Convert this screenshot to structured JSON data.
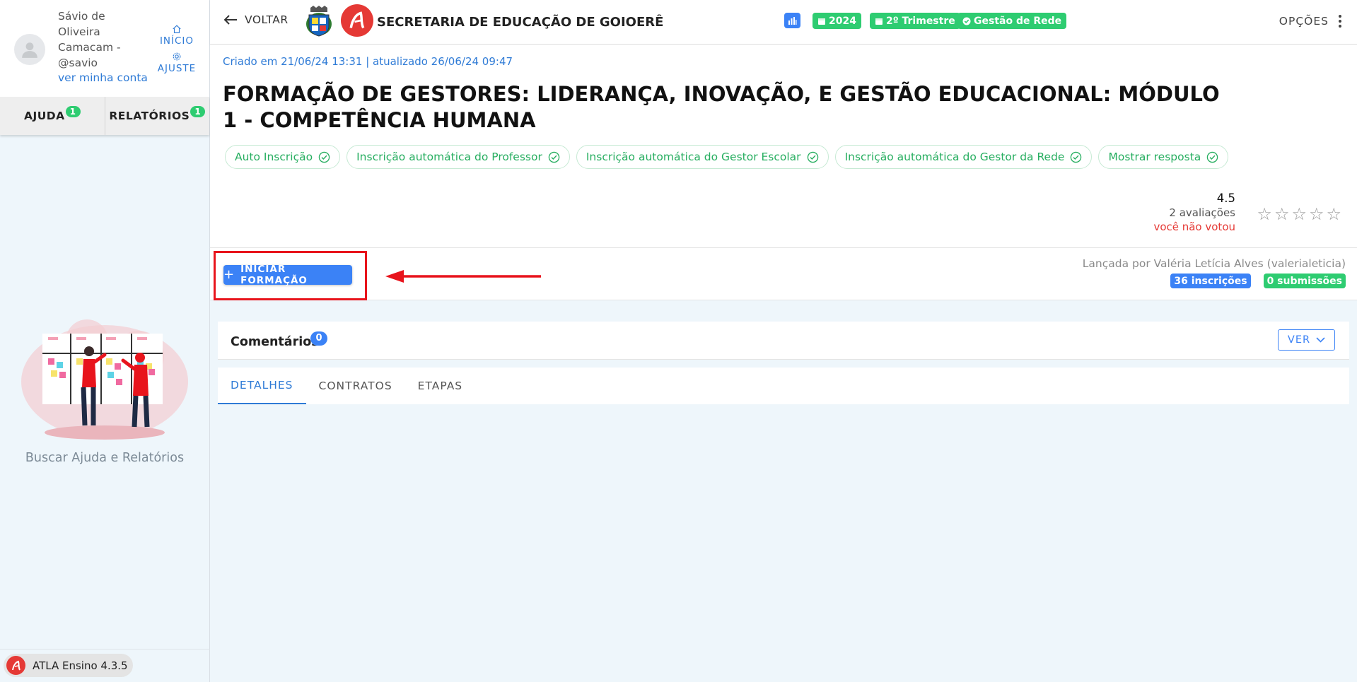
{
  "sidebar": {
    "user_name": "Sávio de Oliveira Camacam - @savio",
    "my_account_link": "ver minha conta",
    "quick_links": [
      {
        "label": "INÍCIO",
        "icon": "home-icon"
      },
      {
        "label": "AJUSTE",
        "icon": "gear-icon"
      }
    ],
    "tabs": [
      {
        "label": "AJUDA",
        "count": "1"
      },
      {
        "label": "RELATÓRIOS",
        "count": "1"
      }
    ],
    "help_caption": "Buscar Ajuda e Relatórios",
    "version": "ATLA Ensino 4.3.5"
  },
  "topbar": {
    "back_label": "VOLTAR",
    "institution": "SECRETARIA DE EDUCAÇÃO DE GOIOERÊ",
    "badges": [
      {
        "label": "2024",
        "icon": "calendar-icon"
      },
      {
        "label": "2º Trimestre",
        "icon": "calendar-icon"
      },
      {
        "label": "Gestão de Rede",
        "icon": "check-circle-icon"
      }
    ],
    "options_label": "OPÇÕES"
  },
  "course": {
    "meta": "Criado em 21/06/24 13:31 | atualizado 26/06/24 09:47",
    "title": "FORMAÇÃO DE GESTORES: LIDERANÇA, INOVAÇÃO, E GESTÃO EDUCACIONAL: MÓDULO 1 - COMPETÊNCIA HUMANA",
    "chips": [
      "Auto Inscrição",
      "Inscrição automática do Professor",
      "Inscrição automática do Gestor Escolar",
      "Inscrição automática do Gestor da Rede",
      "Mostrar resposta"
    ],
    "rating": {
      "score": "4.5",
      "count": "2 avaliações",
      "voted_status": "você não votou",
      "stars_filled": 0,
      "stars_total": 5
    }
  },
  "actions": {
    "start_button": "INICIAR FORMAÇÃO",
    "launched_by": "Lançada por Valéria Letícia Alves (valerialeticia)",
    "enrollments": "36 inscrições",
    "submissions": "0 submissões"
  },
  "comments": {
    "title": "Comentários",
    "count": "0",
    "view_button": "VER"
  },
  "tabs": [
    "DETALHES",
    "CONTRATOS",
    "ETAPAS"
  ],
  "colors": {
    "primary": "#3b82f6",
    "success": "#2ecc71",
    "brand_red": "#e53935",
    "highlight": "#e8141c"
  }
}
